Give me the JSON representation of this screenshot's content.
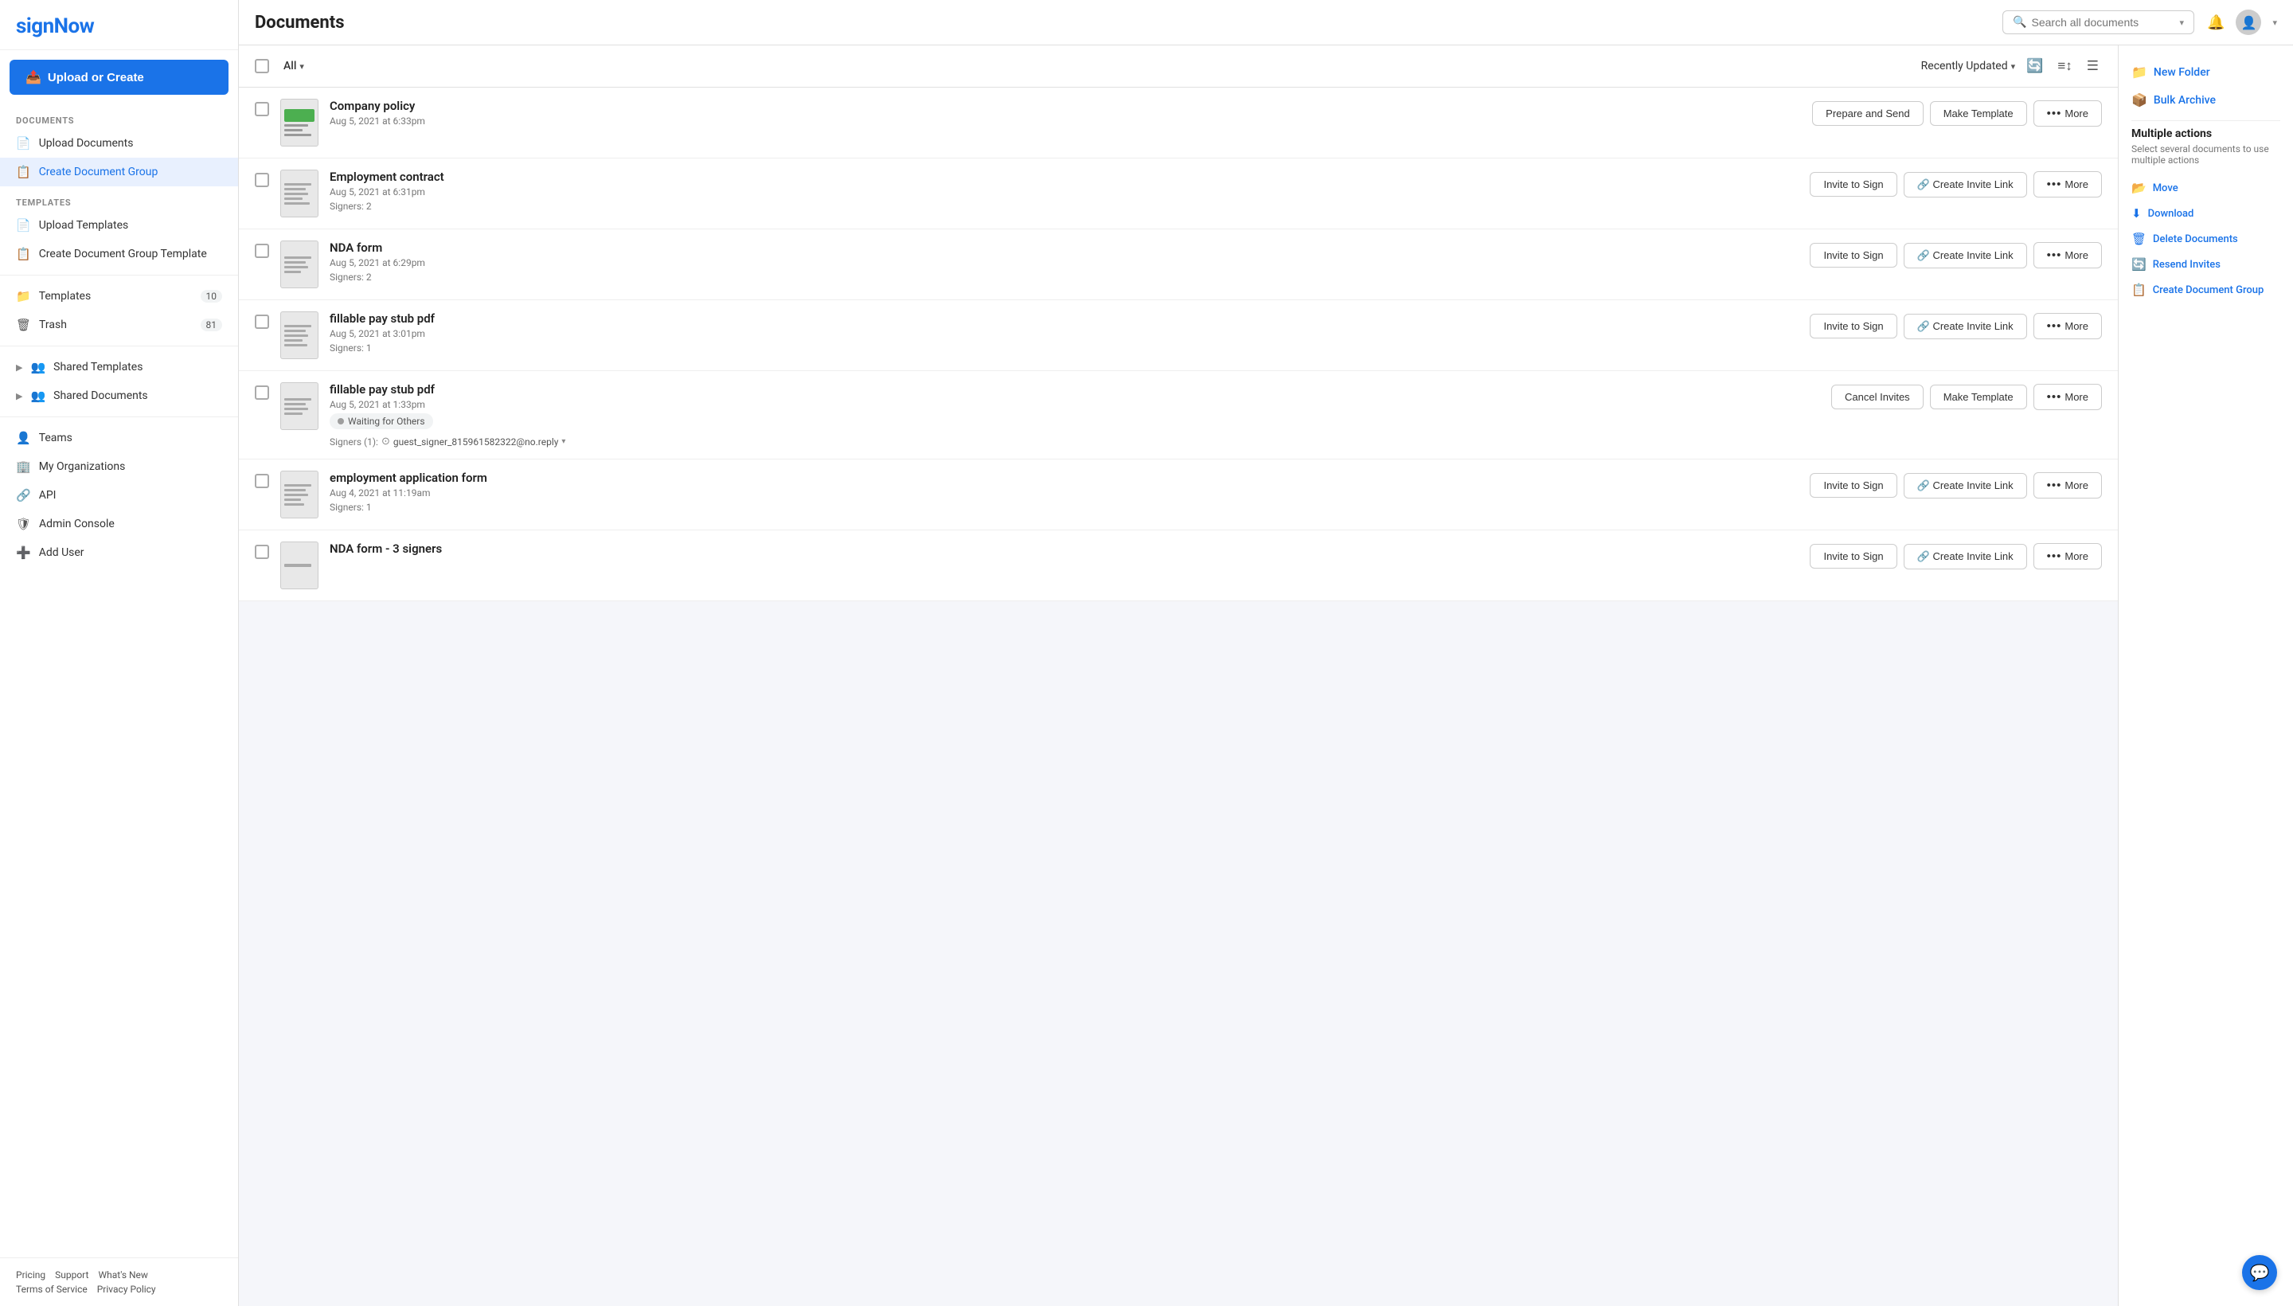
{
  "app": {
    "name": "signNow"
  },
  "sidebar": {
    "upload_btn": "Upload or Create",
    "documents_label": "DOCUMENTS",
    "templates_label": "TEMPLATES",
    "items": [
      {
        "id": "upload-documents",
        "label": "Upload Documents",
        "icon": "📄",
        "count": null
      },
      {
        "id": "create-document-group",
        "label": "Create Document Group",
        "icon": "📋",
        "count": null,
        "active": true
      },
      {
        "id": "upload-templates",
        "label": "Upload Templates",
        "icon": "📄",
        "count": null
      },
      {
        "id": "create-doc-group-template",
        "label": "Create Document Group Template",
        "icon": "📋",
        "count": null
      },
      {
        "id": "templates",
        "label": "Templates",
        "icon": "📁",
        "count": "10"
      },
      {
        "id": "trash",
        "label": "Trash",
        "icon": "🗑",
        "count": "81"
      }
    ],
    "expandable": [
      {
        "id": "shared-templates",
        "label": "Shared Templates",
        "icon": "👥"
      },
      {
        "id": "shared-documents",
        "label": "Shared Documents",
        "icon": "👥"
      }
    ],
    "bottom_items": [
      {
        "id": "teams",
        "label": "Teams",
        "icon": "👤"
      },
      {
        "id": "my-organizations",
        "label": "My Organizations",
        "icon": "🏢"
      },
      {
        "id": "api",
        "label": "API",
        "icon": "🔗"
      },
      {
        "id": "admin-console",
        "label": "Admin Console",
        "icon": "🛡"
      },
      {
        "id": "add-user",
        "label": "Add User",
        "icon": "➕"
      }
    ],
    "footer_links": [
      "Pricing",
      "Support",
      "What's New",
      "Terms of Service",
      "Privacy Policy"
    ]
  },
  "topbar": {
    "page_title": "Documents",
    "search_placeholder": "Search all documents",
    "notification_icon": "🔔",
    "avatar_icon": "👤"
  },
  "filter_bar": {
    "all_label": "All",
    "sort_label": "Recently Updated",
    "icons": [
      "refresh",
      "filter",
      "list"
    ]
  },
  "documents": [
    {
      "id": "doc-1",
      "name": "Company policy",
      "date": "Aug 5, 2021 at 6:33pm",
      "signers": null,
      "status": null,
      "signer_email": null,
      "actions": [
        "Prepare and Send",
        "Make Template",
        "More"
      ],
      "thumb_type": "green"
    },
    {
      "id": "doc-2",
      "name": "Employment contract",
      "date": "Aug 5, 2021 at 6:31pm",
      "signers": "Signers: 2",
      "status": null,
      "signer_email": null,
      "actions": [
        "Invite to Sign",
        "Create Invite Link",
        "More"
      ],
      "thumb_type": "lines"
    },
    {
      "id": "doc-3",
      "name": "NDA form",
      "date": "Aug 5, 2021 at 6:29pm",
      "signers": "Signers: 2",
      "status": null,
      "signer_email": null,
      "actions": [
        "Invite to Sign",
        "Create Invite Link",
        "More"
      ],
      "thumb_type": "lines"
    },
    {
      "id": "doc-4",
      "name": "fillable pay stub pdf",
      "date": "Aug 5, 2021 at 3:01pm",
      "signers": "Signers: 1",
      "status": null,
      "signer_email": null,
      "actions": [
        "Invite to Sign",
        "Create Invite Link",
        "More"
      ],
      "thumb_type": "lines"
    },
    {
      "id": "doc-5",
      "name": "fillable pay stub pdf",
      "date": "Aug 5, 2021 at 1:33pm",
      "signers": "Signers (1):",
      "status": "Waiting for Others",
      "signer_email": "guest_signer_815961582322@no.reply",
      "actions": [
        "Cancel Invites",
        "Make Template",
        "More"
      ],
      "thumb_type": "lines"
    },
    {
      "id": "doc-6",
      "name": "employment application form",
      "date": "Aug 4, 2021 at 11:19am",
      "signers": "Signers: 1",
      "status": null,
      "signer_email": null,
      "actions": [
        "Invite to Sign",
        "Create Invite Link",
        "More"
      ],
      "thumb_type": "lines"
    },
    {
      "id": "doc-7",
      "name": "NDA form - 3 signers",
      "date": "",
      "signers": null,
      "status": null,
      "signer_email": null,
      "actions": [
        "Invite to Sign",
        "Create Invite Link",
        "More"
      ],
      "thumb_type": "dash"
    }
  ],
  "right_panel": {
    "actions": [
      {
        "id": "new-folder",
        "label": "New Folder",
        "icon": "📁"
      },
      {
        "id": "bulk-archive",
        "label": "Bulk Archive",
        "icon": "📦"
      }
    ],
    "multiple_actions": {
      "title": "Multiple actions",
      "desc": "Select several documents to use multiple actions",
      "items": [
        {
          "id": "move",
          "label": "Move",
          "icon": "📂"
        },
        {
          "id": "download",
          "label": "Download",
          "icon": "⬇"
        },
        {
          "id": "delete-documents",
          "label": "Delete Documents",
          "icon": "🗑"
        },
        {
          "id": "resend-invites",
          "label": "Resend Invites",
          "icon": "🔄"
        },
        {
          "id": "create-doc-group",
          "label": "Create Document Group",
          "icon": "📋"
        }
      ]
    }
  },
  "chat_fab": {
    "icon": "💬"
  }
}
